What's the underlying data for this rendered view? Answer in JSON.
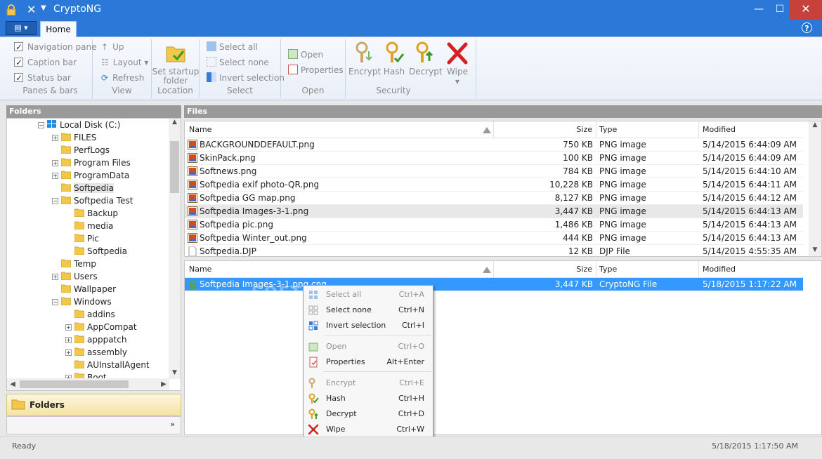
{
  "window": {
    "title": "CryptoNG",
    "minimize_glyph": "—",
    "maximize_glyph": "☐",
    "close_glyph": "✕"
  },
  "colors": {
    "titlebar": "#2b78d8",
    "selection": "#3399ff",
    "close": "#c7403a",
    "folder": "#f2c84b"
  },
  "tabs": {
    "home": "Home"
  },
  "ribbon": {
    "panes": {
      "label": "Panes & bars",
      "navigation_pane": "Navigation pane",
      "caption_bar": "Caption bar",
      "status_bar": "Status bar"
    },
    "view": {
      "label": "View",
      "up": "Up",
      "layout": "Layout",
      "refresh": "Refresh"
    },
    "location": {
      "label": "Location",
      "set_startup_folder_1": "Set startup",
      "set_startup_folder_2": "folder"
    },
    "select": {
      "label": "Select",
      "select_all": "Select all",
      "select_none": "Select none",
      "invert_selection": "Invert selection"
    },
    "open": {
      "label": "Open",
      "open": "Open",
      "properties": "Properties"
    },
    "security": {
      "label": "Security",
      "encrypt": "Encrypt",
      "hash": "Hash",
      "decrypt": "Decrypt",
      "wipe": "Wipe"
    }
  },
  "panels": {
    "folders": "Folders",
    "files": "Files"
  },
  "tree": {
    "root": "Local Disk (C:)",
    "items": [
      "FILES",
      "PerfLogs",
      "Program Files",
      "ProgramData",
      "Softpedia",
      "Softpedia Test",
      "Backup",
      "media",
      "Pic",
      "Softpedia",
      "Temp",
      "Users",
      "Wallpaper",
      "Windows",
      "addins",
      "AppCompat",
      "apppatch",
      "assembly",
      "AUInstallAgent",
      "Boot"
    ]
  },
  "nav": {
    "folders": "Folders",
    "more": "»"
  },
  "columns": {
    "name": "Name",
    "size": "Size",
    "type": "Type",
    "modified": "Modified"
  },
  "files_top": [
    {
      "name": "BACKGROUNDDEFAULT.png",
      "size": "750 KB",
      "type": "PNG image",
      "modified": "5/14/2015 6:44:09 AM"
    },
    {
      "name": "SkinPack.png",
      "size": "100 KB",
      "type": "PNG image",
      "modified": "5/14/2015 6:44:09 AM"
    },
    {
      "name": "Softnews.png",
      "size": "784 KB",
      "type": "PNG image",
      "modified": "5/14/2015 6:44:10 AM"
    },
    {
      "name": "Softpedia exif photo-QR.png",
      "size": "10,228 KB",
      "type": "PNG image",
      "modified": "5/14/2015 6:44:11 AM"
    },
    {
      "name": "Softpedia GG map.png",
      "size": "8,127 KB",
      "type": "PNG image",
      "modified": "5/14/2015 6:44:12 AM"
    },
    {
      "name": "Softpedia Images-3-1.png",
      "size": "3,447 KB",
      "type": "PNG image",
      "modified": "5/14/2015 6:44:13 AM"
    },
    {
      "name": "Softpedia pic.png",
      "size": "1,486 KB",
      "type": "PNG image",
      "modified": "5/14/2015 6:44:13 AM"
    },
    {
      "name": "Softpedia Winter_out.png",
      "size": "444 KB",
      "type": "PNG image",
      "modified": "5/14/2015 6:44:13 AM"
    },
    {
      "name": "Softpedia.DJP",
      "size": "12 KB",
      "type": "DJP File",
      "modified": "5/14/2015 4:55:35 AM"
    }
  ],
  "files_bottom": [
    {
      "name": "Softpedia Images-3-1.png.cng",
      "size": "3,447 KB",
      "type": "CryptoNG File",
      "modified": "5/18/2015 1:17:22 AM"
    }
  ],
  "context_menu": [
    {
      "label": "Select all",
      "shortcut": "Ctrl+A"
    },
    {
      "label": "Select none",
      "shortcut": "Ctrl+N"
    },
    {
      "label": "Invert  selection",
      "shortcut": "Ctrl+I"
    },
    {
      "label": "Open",
      "shortcut": "Ctrl+O"
    },
    {
      "label": "Properties",
      "shortcut": "Alt+Enter"
    },
    {
      "label": "Encrypt",
      "shortcut": "Ctrl+E"
    },
    {
      "label": "Hash",
      "shortcut": "Ctrl+H"
    },
    {
      "label": "Decrypt",
      "shortcut": "Ctrl+D"
    },
    {
      "label": "Wipe",
      "shortcut": "Ctrl+W"
    }
  ],
  "status": {
    "left": "Ready",
    "right": "5/18/2015 1:17:50 AM"
  },
  "watermark": "SOFTPEDIA"
}
